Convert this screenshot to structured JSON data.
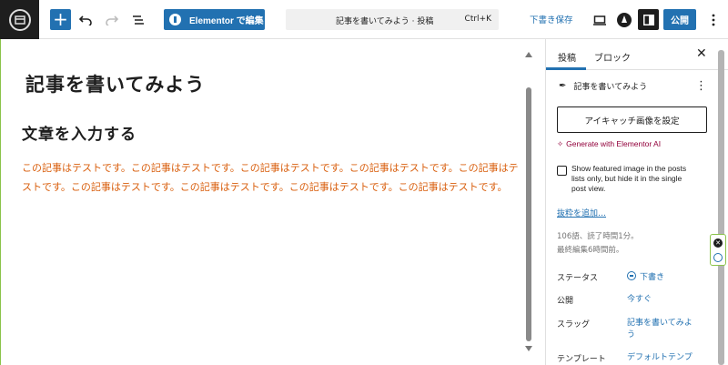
{
  "toolbar": {
    "elementor_label": "Elementor で編集",
    "command_title": "記事を書いてみよう · 投稿",
    "command_shortcut": "Ctrl+K",
    "save_draft": "下書き保存",
    "publish": "公開"
  },
  "editor": {
    "post_title": "記事を書いてみよう",
    "heading": "文章を入力する",
    "paragraph": "この記事はテストです。この記事はテストです。この記事はテストです。この記事はテストです。この記事はテストです。この記事はテストです。この記事はテストです。この記事はテストです。この記事はテストです。"
  },
  "sidebar": {
    "tabs": [
      {
        "label": "投稿",
        "active": true
      },
      {
        "label": "ブロック",
        "active": false
      }
    ],
    "post_name": "記事を書いてみよう",
    "featured_image_button": "アイキャッチ画像を設定",
    "generate_ai": "Generate with Elementor AI",
    "featured_checkbox": {
      "checked": false,
      "label": "Show featured image in the posts lists only, but hide it in the single post view."
    },
    "excerpt_link": "抜粋を追加…",
    "meta_words": "106語、読了時間1分。",
    "meta_edited": "最終編集6時間前。",
    "rows": [
      {
        "label": "ステータス",
        "value": "下書き"
      },
      {
        "label": "公開",
        "value": "今すぐ"
      },
      {
        "label": "スラッグ",
        "value": "記事を書いてみよう"
      },
      {
        "label": "テンプレート",
        "value": "デフォルトテンプ"
      }
    ]
  },
  "colors": {
    "accent": "#2271b1",
    "paragraph_text": "#d95f0e",
    "ai_link": "#92003b",
    "dark": "#1e1e1e"
  },
  "icons": [
    "wordpress-logo-icon",
    "plus-icon",
    "undo-icon",
    "redo-icon",
    "document-overview-icon",
    "elementor-icon",
    "preview-icon",
    "jetpack-icon",
    "settings-icon",
    "more-vertical-icon",
    "close-icon",
    "feather-icon",
    "sparkle-icon",
    "status-icon"
  ]
}
